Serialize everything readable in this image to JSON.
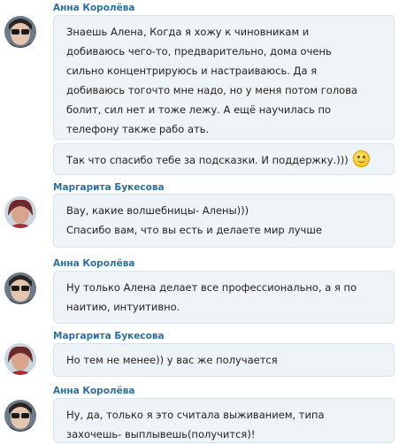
{
  "messages": [
    {
      "author": "Анна Королёва",
      "avatar": "anna-avatar",
      "bubbles": [
        [
          "Знаешь Алена, Когда я хожу к чиновникам и",
          "добиваюсь чего-то, предварительно, дома очень",
          "сильно концентрируюсь и настраиваюсь. Да я",
          "добиваюсь тогочто мне надо, но у меня потом голова",
          "болит, сил нет и тоже лежу. А ещё научилась по",
          "телефону также рабо ать."
        ],
        [
          "Так что спасибо тебе за подсказки. И поддержку.)))"
        ]
      ]
    },
    {
      "author": "Маргарита Букесова",
      "avatar": "margarita-avatar",
      "bubbles": [
        [
          " Вау, какие волшебницы- Алены)))",
          "Спасибо вам, что вы есть и делаете мир лучше"
        ]
      ]
    },
    {
      "author": "Анна Королёва",
      "avatar": "anna-avatar",
      "bubbles": [
        [
          "Ну только Алена делает все профессионально, а я  по",
          "наитию, интуитивно."
        ]
      ]
    },
    {
      "author": "Маргарита Букесова",
      "avatar": "margarita-avatar",
      "bubbles": [
        [
          "Но тем не менее)) у вас же получается"
        ]
      ]
    },
    {
      "author": "Анна Королёва",
      "avatar": "anna-avatar",
      "bubbles": [
        [
          "Ну, да, только я это считала выживанием, типа",
          "захочешь- выплывешь(получится)!"
        ]
      ]
    }
  ],
  "icons": {
    "smile": "smile-emoji-icon"
  },
  "colors": {
    "author": "#2a6fa1",
    "bubble_bg": "#eef4f8",
    "bubble_border": "#d6e3ec"
  }
}
